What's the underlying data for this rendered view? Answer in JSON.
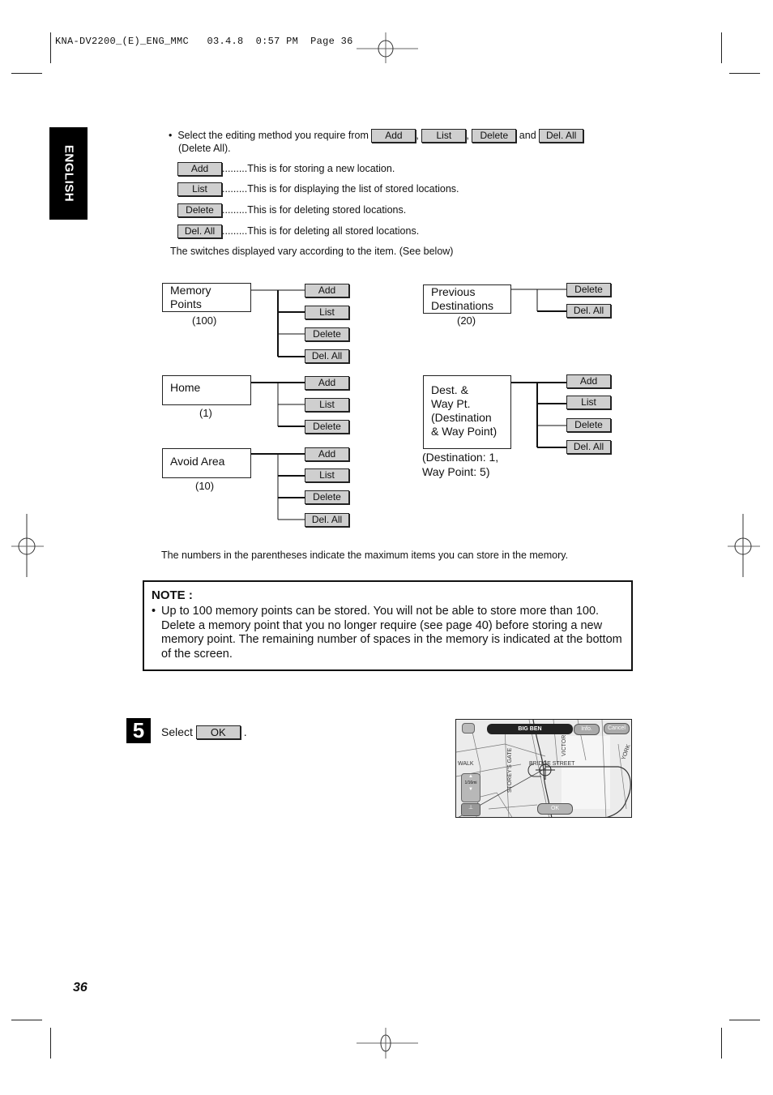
{
  "print_header": {
    "job": "KNA-DV2200_(E)_ENG_MMC",
    "date": "03.4.8",
    "time": "0:57 PM",
    "page_label": "Page 36"
  },
  "language_tab": "ENGLISH",
  "intro": {
    "bullet": "•",
    "text_before": "Select the editing method you require from",
    "buttons": [
      "Add",
      "List",
      "Delete",
      "Del. All"
    ],
    "sep1": ",",
    "sep2": ",",
    "and": "and",
    "text_after": "(Delete All)."
  },
  "definitions": [
    {
      "button": "Add",
      "dots": ".........",
      "desc": "This is for storing a new location."
    },
    {
      "button": "List",
      "dots": ".........",
      "desc": "This is for displaying the list of stored locations."
    },
    {
      "button": "Delete",
      "dots": ".........",
      "desc": "This is for deleting stored locations."
    },
    {
      "button": "Del. All",
      "dots": ".........",
      "desc": "This is for deleting all stored locations."
    }
  ],
  "switch_note": "The switches displayed vary according to the item. (See below)",
  "diagram": {
    "items": [
      {
        "name": "Memory Points",
        "line1": "Memory",
        "line2": "Points",
        "max": "(100)",
        "switches": [
          "Add",
          "List",
          "Delete",
          "Del. All"
        ]
      },
      {
        "name": "Home",
        "line1": "Home",
        "line2": "",
        "max": "(1)",
        "switches": [
          "Add",
          "List",
          "Delete"
        ]
      },
      {
        "name": "Avoid Area",
        "line1": "Avoid Area",
        "line2": "",
        "max": "(10)",
        "switches": [
          "Add",
          "List",
          "Delete",
          "Del. All"
        ]
      },
      {
        "name": "Previous Destinations",
        "line1": "Previous",
        "line2": "Destinations",
        "max": "(20)",
        "switches": [
          "Delete",
          "Del. All"
        ]
      },
      {
        "name": "Dest. & Way Pt.",
        "lines": [
          "Dest. &",
          "Way Pt.",
          "(Destination",
          "& Way Point)"
        ],
        "max_line1": "(Destination: 1,",
        "max_line2": "Way Point: 5)",
        "switches": [
          "Add",
          "List",
          "Delete",
          "Del. All"
        ]
      }
    ]
  },
  "parentheses_note": "The numbers in the parentheses indicate the maximum items you can store in the memory.",
  "note": {
    "title": "NOTE :",
    "bullet": "•",
    "text": "Up to 100 memory points can be stored. You will not be able to store more than 100. Delete a memory point that you no longer require (see page 40) before storing a new memory point. The remaining number of spaces in the memory is indicated at the bottom of the screen."
  },
  "step5": {
    "number": "5",
    "text": "Select",
    "button": "OK",
    "period": "."
  },
  "map_screen": {
    "place_name": "BIG BEN",
    "info_button": "Info.",
    "cancel_button": "Cancel",
    "ok_button": "OK",
    "scale": "1/16mi",
    "street_labels": [
      "BRIDGE STREET",
      "VICTORIA",
      "STOREY'S GATE",
      "YORK",
      "WALK"
    ]
  },
  "page_number": "36"
}
